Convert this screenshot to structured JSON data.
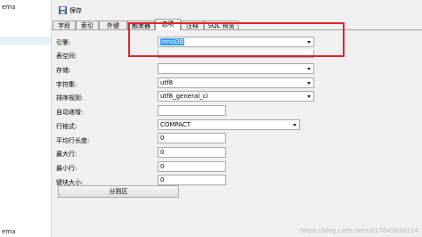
{
  "left_panel": {
    "top_item": "ema",
    "bottom_item": "ema"
  },
  "toolbar": {
    "save_label": "保存"
  },
  "tabs": [
    {
      "label": "字段"
    },
    {
      "label": "索引"
    },
    {
      "label": "外键"
    },
    {
      "label": "触发器"
    },
    {
      "label": "选项",
      "active": true
    },
    {
      "label": "注释"
    },
    {
      "label": "SQL 预览"
    }
  ],
  "form": {
    "engine": {
      "label": "引擎:",
      "value": "InnoDB"
    },
    "tablespace": {
      "label": "表空间:",
      "value": ""
    },
    "storage": {
      "label": "存储:",
      "value": ""
    },
    "charset": {
      "label": "字符集:",
      "value": "utf8"
    },
    "collation": {
      "label": "排序规则:",
      "value": "utf8_general_ci"
    },
    "auto_increment": {
      "label": "自动递增:",
      "value": ""
    },
    "row_format": {
      "label": "行格式:",
      "value": "COMPACT"
    },
    "avg_row_length": {
      "label": "平均行长度:",
      "value": "0"
    },
    "max_rows": {
      "label": "最大行:",
      "value": "0"
    },
    "min_rows": {
      "label": "最小行:",
      "value": "0"
    },
    "key_block_size": {
      "label": "键块大小:",
      "value": "0"
    }
  },
  "partition_button": "分割区",
  "watermark": "https://blog.csdn.net/u017845838214",
  "colors": {
    "highlight_box": "#e0242e",
    "selection": "#3399ff"
  }
}
